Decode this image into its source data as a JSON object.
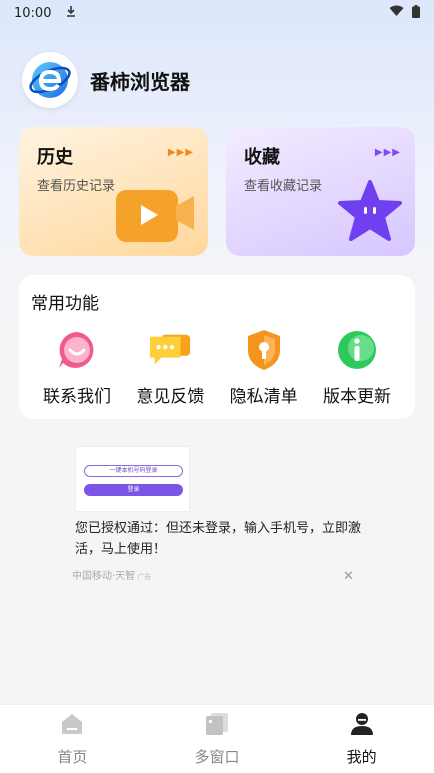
{
  "status_bar": {
    "time": "10:00"
  },
  "profile": {
    "app_name": "番柿浏览器"
  },
  "cards": {
    "history": {
      "title": "历史",
      "subtitle": "查看历史记录"
    },
    "favorites": {
      "title": "收藏",
      "subtitle": "查看收藏记录"
    }
  },
  "features": {
    "title": "常用功能",
    "items": [
      {
        "label": "联系我们",
        "icon": "chat-face-icon"
      },
      {
        "label": "意见反馈",
        "icon": "feedback-icon"
      },
      {
        "label": "隐私清单",
        "icon": "privacy-shield-icon"
      },
      {
        "label": "版本更新",
        "icon": "info-icon"
      }
    ]
  },
  "ad": {
    "image_pill": "一键本机号码登录",
    "image_button": "登录",
    "text": "您已授权通过：但还未登录，输入手机号，立即激活，马上使用！",
    "source": "中国移动·天智",
    "tag": "广告"
  },
  "tab_bar": {
    "tabs": [
      {
        "label": "首页",
        "icon": "home-icon"
      },
      {
        "label": "多窗口",
        "icon": "windows-icon"
      },
      {
        "label": "我的",
        "icon": "user-icon"
      }
    ]
  },
  "colors": {
    "history_accent": "#f5a22a",
    "favorites_accent": "#6f3ff0",
    "privacy_orange": "#f5951f",
    "update_green": "#2fc85b",
    "contact_pink": "#f05b8c"
  }
}
